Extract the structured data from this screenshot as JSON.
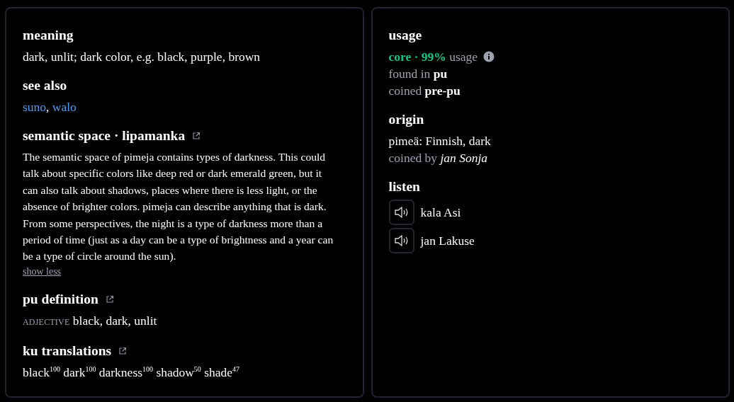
{
  "left": [
    {
      "kind": "text",
      "heading": "meaning",
      "external_link": false,
      "text": "dark, unlit; dark color, e.g. black, purple, brown"
    },
    {
      "kind": "links",
      "heading": "see also",
      "external_link": false,
      "links": [
        "suno",
        "walo"
      ],
      "separator": ","
    },
    {
      "kind": "paragraph",
      "heading": "semantic space · lipamanka",
      "external_link": true,
      "text": "The semantic space of pimeja contains types of darkness. This could talk about specific colors like deep red or dark emerald green, but it can also talk about shadows, places where there is less light, or the absence of brighter colors. pimeja can describe anything that is dark. From some perspectives, the night is a type of darkness more than a period of time (just as a day can be a type of brightness and a year can be a type of circle around the sun).",
      "toggle": "show less"
    },
    {
      "kind": "definition",
      "heading": "pu definition",
      "external_link": true,
      "part_of_speech": "ADJECTIVE",
      "text": "black, dark, unlit"
    },
    {
      "kind": "text",
      "heading": "ku translations",
      "external_link": true,
      "text": "black$^{100}$ dark$^{100}$ darkness$^{100}$ shadow$^{50}$ shade$^{47}$"
    }
  ],
  "right": [
    {
      "kind": "usage",
      "heading": "usage",
      "external_link": false,
      "tier": "core · 99%",
      "tier_suffix": "usage",
      "info": true,
      "lines": [
        "found in **pu**",
        "coined **pre-pu**"
      ]
    },
    {
      "kind": "origin",
      "heading": "origin",
      "external_link": false,
      "text": "pimeä: Finnish, dark",
      "lines": [
        "coined by *jan Sonja*"
      ]
    },
    {
      "kind": "audio",
      "heading": "listen",
      "external_link": false,
      "speakers": [
        "kala Asi",
        "jan Lakuse"
      ]
    }
  ]
}
